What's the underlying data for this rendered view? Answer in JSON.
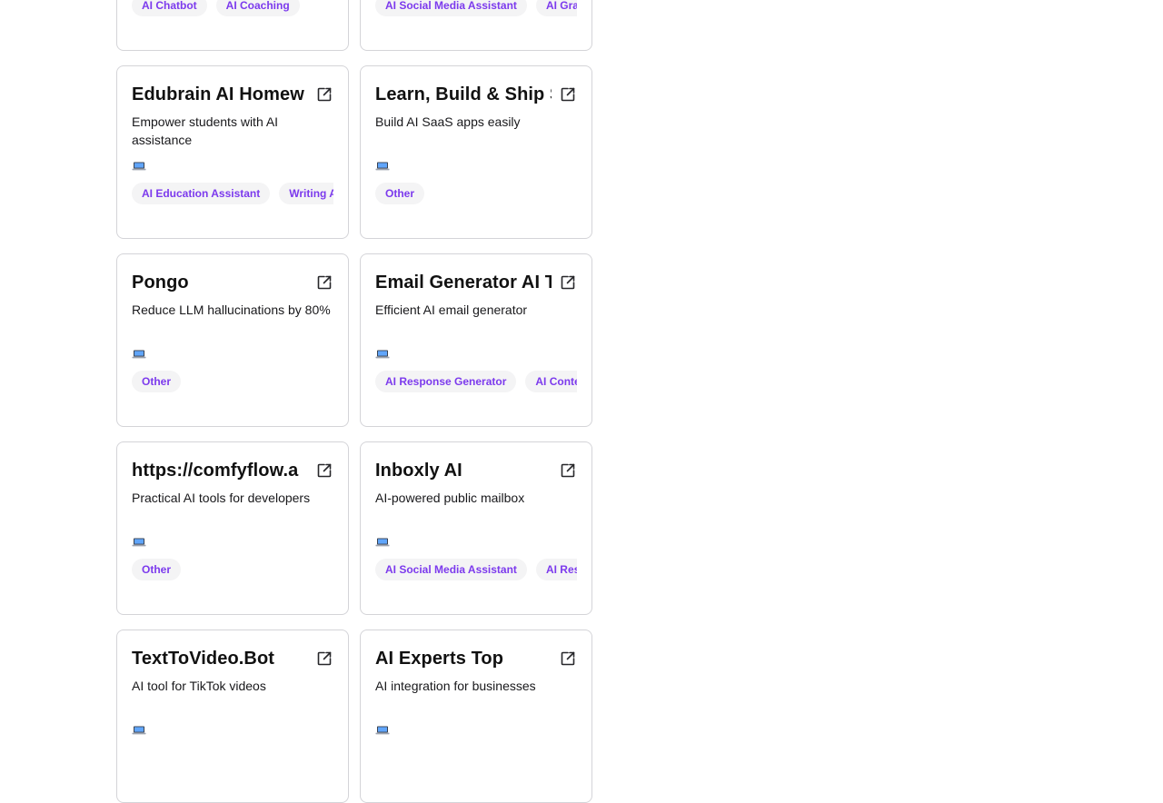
{
  "colors": {
    "tag_text": "#7c3aed",
    "tag_bg": "#f4f4f5",
    "card_border": "#d4d4d8",
    "laptop_screen": "#3b82f6"
  },
  "icons": {
    "external_link": "external-link-icon",
    "platform": "laptop-icon"
  },
  "cards": [
    {
      "title": "",
      "description": "",
      "tags": [
        "AI Chatbot",
        "AI Coaching"
      ]
    },
    {
      "title": "",
      "description": "",
      "tags": [
        "AI Social Media Assistant",
        "AI Gra"
      ]
    },
    {
      "title": "Edubrain AI Homew",
      "description": "Empower students with AI assistance",
      "tags": [
        "AI Education Assistant",
        "Writing A"
      ]
    },
    {
      "title": "Learn, Build & Ship S",
      "description": "Build AI SaaS apps easily",
      "tags": [
        "Other"
      ]
    },
    {
      "title": "Pongo",
      "description": "Reduce LLM hallucinations by 80%",
      "tags": [
        "Other"
      ]
    },
    {
      "title": "Email Generator AI T",
      "description": "Efficient AI email generator",
      "tags": [
        "AI Response Generator",
        "AI Conte"
      ]
    },
    {
      "title": "https://comfyflow.a",
      "description": "Practical AI tools for developers",
      "tags": [
        "Other"
      ]
    },
    {
      "title": "Inboxly AI",
      "description": "AI-powered public mailbox",
      "tags": [
        "AI Social Media Assistant",
        "AI Res"
      ]
    },
    {
      "title": "TextToVideo.Bot",
      "description": "AI tool for TikTok videos",
      "tags": []
    },
    {
      "title": "AI Experts Top",
      "description": "AI integration for businesses",
      "tags": []
    }
  ]
}
